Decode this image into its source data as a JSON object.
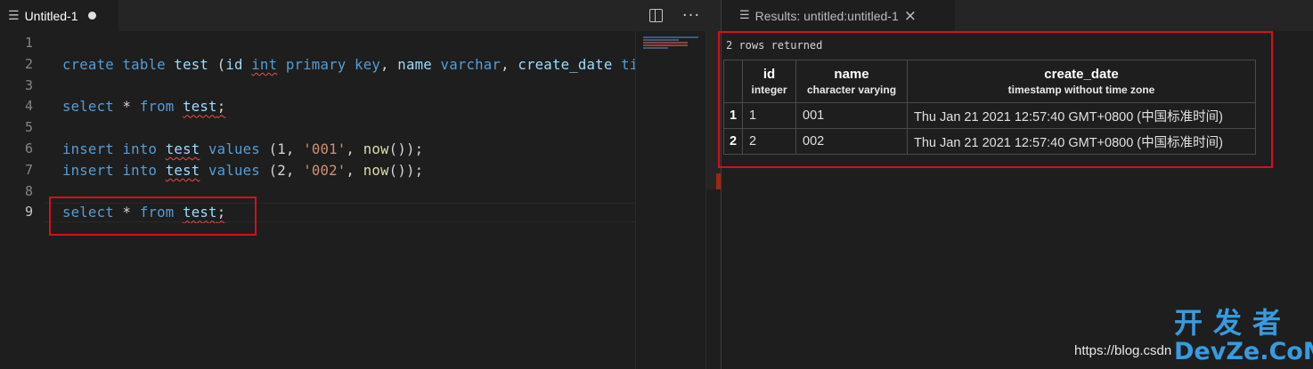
{
  "editor": {
    "tab_title": "Untitled-1",
    "file_icon": "document-icon",
    "more_glyph": "···",
    "line_numbers": [
      "1",
      "2",
      "3",
      "4",
      "5",
      "6",
      "7",
      "8",
      "9"
    ],
    "current_line": "9",
    "code": {
      "line2": [
        "create",
        "table",
        "test",
        "(",
        "id",
        "int",
        "primary",
        "key",
        ",",
        "name",
        "varchar",
        ",",
        "create_date",
        "ti"
      ],
      "line4": [
        "select",
        "*",
        "from",
        "test",
        ";"
      ],
      "line6": [
        "insert",
        "into",
        "test",
        "values",
        "(",
        "1",
        ",",
        "'001'",
        ",",
        "now",
        "()",
        ");"
      ],
      "line7": [
        "insert",
        "into",
        "test",
        "values",
        "(",
        "2",
        ",",
        "'002'",
        ",",
        "now",
        "()",
        ");"
      ],
      "line9": [
        "select",
        "*",
        "from",
        "test",
        ";"
      ]
    }
  },
  "results": {
    "tab_title": "Results: untitled:untitled-1",
    "close_glyph": "×",
    "rows_returned": "2 rows returned",
    "columns": [
      {
        "name": "",
        "type": ""
      },
      {
        "name": "id",
        "type": "integer"
      },
      {
        "name": "name",
        "type": "character varying"
      },
      {
        "name": "create_date",
        "type": "timestamp without time zone"
      }
    ],
    "rows": [
      {
        "num": "1",
        "id": "1",
        "name": "001",
        "create_date": "Thu Jan 21 2021 12:57:40 GMT+0800 (中国标准时间)"
      },
      {
        "num": "2",
        "id": "2",
        "name": "002",
        "create_date": "Thu Jan 21 2021 12:57:40 GMT+0800 (中国标准时间)"
      }
    ]
  },
  "watermark": {
    "url": "https://blog.csdn",
    "logo_cn": "开发者",
    "logo_en": "DevZe.CoM"
  },
  "colors": {
    "highlight_box": "#d70f1c",
    "keyword": "#569cd6",
    "identifier": "#9cdcfe",
    "string": "#ce9178",
    "function": "#dcdcaa"
  }
}
